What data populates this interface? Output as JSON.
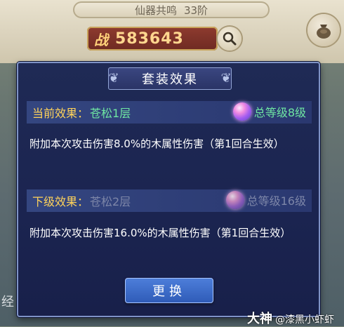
{
  "background": {
    "resonance": {
      "label": "仙器共鸣",
      "level": "33阶"
    },
    "power": {
      "label": "战",
      "value": "583643"
    },
    "side_text": "经",
    "watermark": {
      "brand": "大神",
      "handle": "@漆黑小虾虾"
    }
  },
  "dialog": {
    "title": "套装效果",
    "current": {
      "label": "当前效果：",
      "name": "苍松1层",
      "total": "总等级8级",
      "description": "附加本次攻击伤害8.0%的木属性伤害（第1回合生效）"
    },
    "next": {
      "label": "下级效果：",
      "name": "苍松2层",
      "total": "总等级16级",
      "description": "附加本次攻击伤害16.0%的木属性伤害（第1回合生效）"
    },
    "swap_button": "更换"
  },
  "icons": {
    "search": "search-icon",
    "bag": "bag-icon",
    "orb": "gem-orb-icon",
    "swirl": "ornament-swirl-icon"
  },
  "colors": {
    "accent_gold": "#ffd35a",
    "active_green": "#6fe7a2",
    "inactive_gray": "#7d86a8",
    "button_blue": "#3d6ccb"
  }
}
